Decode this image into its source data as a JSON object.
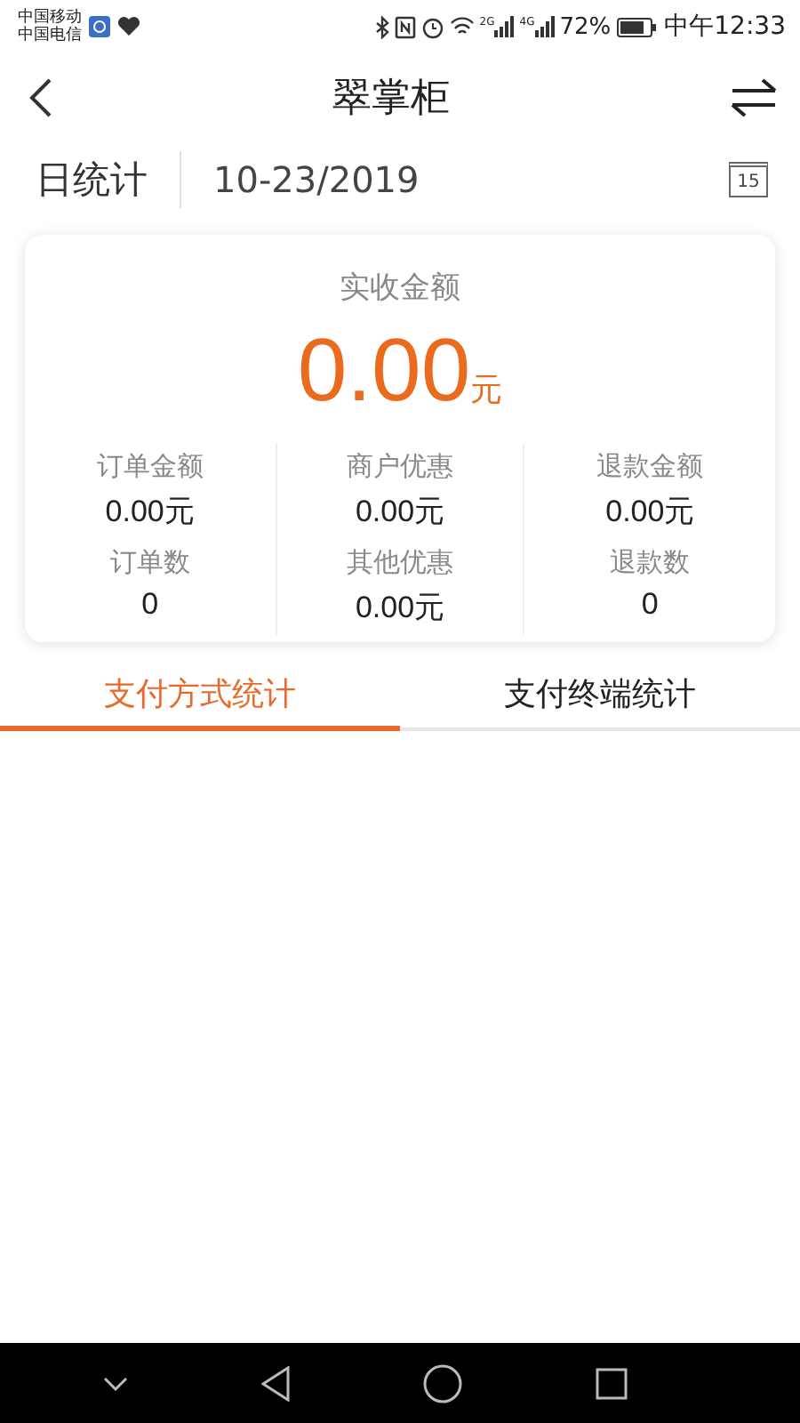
{
  "status_bar": {
    "carriers": [
      "中国移动",
      "中国电信"
    ],
    "network_labels": [
      "2G",
      "4G"
    ],
    "battery": "72%",
    "time": "中午12:33"
  },
  "header": {
    "title": "翠掌柜"
  },
  "date_bar": {
    "period": "日统计",
    "date": "10-23/2019",
    "calendar_day": "15"
  },
  "summary": {
    "label": "实收金额",
    "amount": "0.00",
    "unit": "元",
    "stats": [
      {
        "label": "订单金额",
        "value": "0.00元"
      },
      {
        "label": "商户优惠",
        "value": "0.00元"
      },
      {
        "label": "退款金额",
        "value": "0.00元"
      },
      {
        "label": "订单数",
        "value": "0"
      },
      {
        "label": "其他优惠",
        "value": "0.00元"
      },
      {
        "label": "退款数",
        "value": "0"
      }
    ]
  },
  "tabs": [
    {
      "label": "支付方式统计",
      "selected": true
    },
    {
      "label": "支付终端统计",
      "selected": false
    }
  ]
}
